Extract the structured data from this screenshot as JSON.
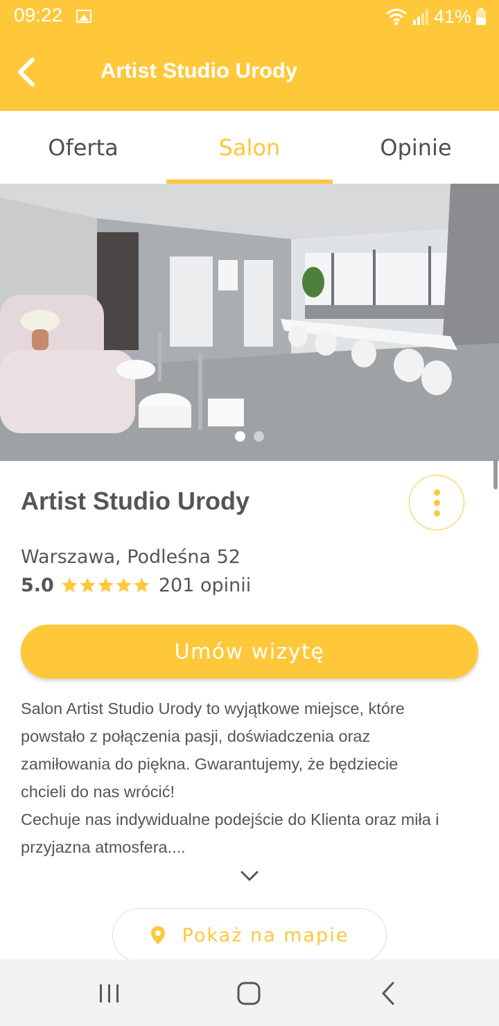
{
  "status_bar": {
    "time": "09:22",
    "battery": "41%",
    "icons": [
      "image-icon",
      "wifi-icon",
      "signal-icon",
      "battery-icon"
    ]
  },
  "app_bar": {
    "title": "Artist Studio Urody",
    "back_icon": "chevron-left-icon"
  },
  "tabs": [
    {
      "label": "Oferta",
      "active": false
    },
    {
      "label": "Salon",
      "active": true
    },
    {
      "label": "Opinie",
      "active": false
    }
  ],
  "gallery": {
    "image_count": 2,
    "current_index": 1
  },
  "salon": {
    "name": "Artist Studio Urody",
    "address": "Warszawa, Podleśna 52",
    "rating": "5.0",
    "stars": 5,
    "reviews": "201 opinii",
    "more_icon": "more-vertical-icon"
  },
  "actions": {
    "book_label": "Umów wizytę",
    "map_label": "Pokaż na mapie",
    "map_icon": "map-pin-icon",
    "expand_icon": "chevron-down-icon"
  },
  "description": {
    "lines": [
      "Salon Artist Studio Urody to wyjątkowe miejsce, które",
      "powstało z połączenia pasji, doświadczenia oraz",
      "zamiłowania do piękna. Gwarantujemy, że będziecie",
      "chcieli do nas wrócić!",
      "Cechuje nas indywidualne podejście do Klienta oraz miła i",
      "przyjazna atmosfera...."
    ]
  },
  "navigation": {
    "recents_icon": "recent-apps-icon",
    "home_icon": "home-icon",
    "back_icon": "back-icon"
  },
  "colors": {
    "accent": "#fec83a",
    "text": "#555555",
    "nav_background": "#f2f2f2"
  }
}
